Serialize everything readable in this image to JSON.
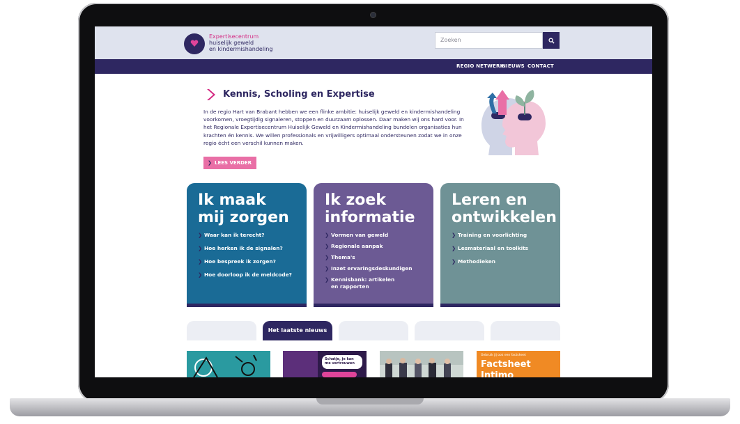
{
  "logo": {
    "line1": "Expertisecentrum",
    "line2": "huiselijk geweld",
    "line3": "en kindermishandeling"
  },
  "search": {
    "placeholder": "Zoeken",
    "icon": "search-icon"
  },
  "nav": {
    "items": [
      "REGIO NETWERK",
      "NIEUWS",
      "CONTACT"
    ]
  },
  "intro": {
    "title": "Kennis, Scholing en Expertise",
    "text": "In de regio Hart van Brabant hebben we een flinke ambitie: huiselijk geweld en kindermishandeling voorkomen, vroegtijdig signaleren, stoppen en duurzaam oplossen. Daar maken wij ons hard voor. In het Regionale Expertisecentrum Huiselijk Geweld en Kindermishandeling bundelen organisaties hun krachten én kennis. We willen professionals en vrijwilligers optimaal ondersteunen zodat we in onze regio écht een verschil kunnen maken.",
    "button": "LEES VERDER"
  },
  "cards": [
    {
      "title_line1": "Ik maak",
      "title_line2": "mij zorgen",
      "color": "#1a6b96",
      "links": [
        "Waar kan ik terecht?",
        "Hoe herken ik de signalen?",
        "Hoe bespreek ik zorgen?",
        "Hoe doorloop ik de meldcode?"
      ]
    },
    {
      "title_line1": "Ik zoek",
      "title_line2": "informatie",
      "color": "#6c5a94",
      "links": [
        "Vormen van geweld",
        "Regionale aanpak",
        "Thema's",
        "Inzet ervaringsdeskundigen",
        "Kennisbank: artikelen en rapporten"
      ]
    },
    {
      "title_line1": "Leren en",
      "title_line2": "ontwikkelen",
      "color": "#6f9296",
      "links": [
        "Training en voorlichting",
        "Lesmateriaal en toolkits",
        "Methodieken"
      ]
    }
  ],
  "tabs": {
    "active": "Het laatste nieuws"
  },
  "thumbs": {
    "banner_text": "Gebruik jij ook een factsheet",
    "factsheet_title": "Factsheet",
    "factsheet_sub": "Intimo",
    "poster_text_1": "Schatje, je kan",
    "poster_text_2": "me vertrouwen"
  },
  "colors": {
    "navy": "#2e2761",
    "pink": "#d42b83",
    "header_bg": "#dfe3ee"
  }
}
